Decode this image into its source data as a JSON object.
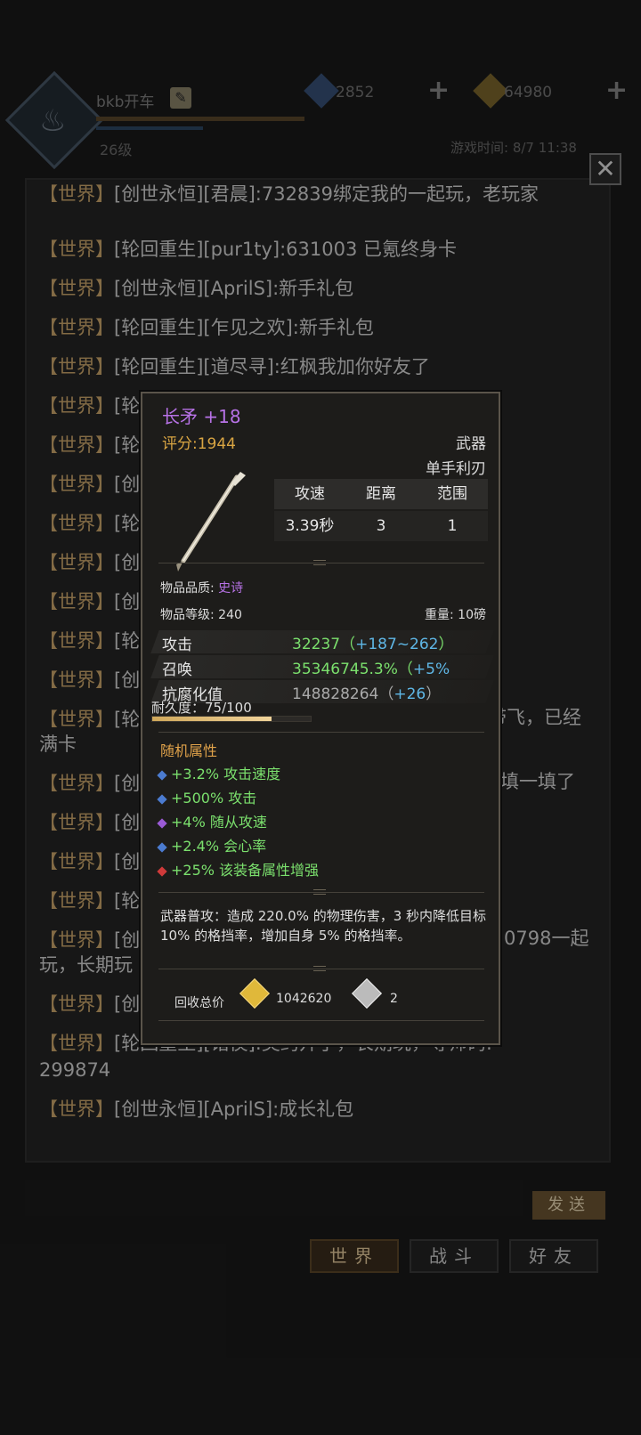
{
  "hud": {
    "player_name": "bkb开车",
    "level": "26级",
    "gems": "2852",
    "gold": "64980",
    "game_time": "游戏时间: 8/7 11:38"
  },
  "chat": {
    "lines": [
      {
        "tag": "【世界】",
        "text": "[创世永恒][君晨]:732839绑定我的一起玩，老玩家"
      },
      {
        "tag": "【世界】",
        "text": "[轮回重生][pur1ty]:631003 已氪终身卡"
      },
      {
        "tag": "【世界】",
        "text": "[创世永恒][AprilS]:新手礼包"
      },
      {
        "tag": "【世界】",
        "text": "[轮回重生][乍见之欢]:新手礼包"
      },
      {
        "tag": "【世界】",
        "text": "[轮回重生][道尽寻]:红枫我加你好友了"
      },
      {
        "tag": "【世界】",
        "text": "[轮"
      },
      {
        "tag": "【世界】",
        "text": "[轮"
      },
      {
        "tag": "【世界】",
        "text": "[创"
      },
      {
        "tag": "【世界】",
        "text": "[轮"
      },
      {
        "tag": "【世界】",
        "text": "[创"
      },
      {
        "tag": "【世界】",
        "text": "[创"
      },
      {
        "tag": "【世界】",
        "text": "[轮"
      },
      {
        "tag": "【世界】",
        "text": "[创"
      },
      {
        "tag": "【世界】",
        "text": "[轮"
      },
      {
        "tag": "",
        "text": "满卡"
      },
      {
        "tag": "【世界】",
        "text": "[创"
      },
      {
        "tag": "【世界】",
        "text": "[创"
      },
      {
        "tag": "【世界】",
        "text": "[创"
      },
      {
        "tag": "【世界】",
        "text": "[轮"
      },
      {
        "tag": "【世界】",
        "text": "[创"
      },
      {
        "tag": "",
        "text": "玩，长期玩"
      },
      {
        "tag": "【世界】",
        "text": "[创"
      },
      {
        "tag": "【世界】",
        "text": "[轮回重生][诸侯]:契约开了，长期玩，导师码:"
      },
      {
        "tag": "",
        "text": "299874"
      },
      {
        "tag": "【世界】",
        "text": "[创世永恒][AprilS]:成长礼包"
      }
    ],
    "right_fragments": [
      "带飞，已经",
      "填一填了",
      "0798一起"
    ],
    "send_label": "发送",
    "tabs": [
      "世界",
      "战斗",
      "好友"
    ]
  },
  "item": {
    "name": "长矛 +18",
    "score": "评分:1944",
    "type": "武器",
    "subtype": "单手利刃",
    "stat_headers": [
      "攻速",
      "距离",
      "范围"
    ],
    "stat_values": [
      "3.39秒",
      "3",
      "1"
    ],
    "quality_label": "物品品质:",
    "quality_value": "史诗",
    "level_label": "物品等级:",
    "level_value": "240",
    "weight_label": "重量:",
    "weight_value": "10磅",
    "attributes": [
      {
        "label": "攻击",
        "value": "32237（",
        "bonus": "+187~262",
        "tail": "）"
      },
      {
        "label": "召唤",
        "value": "35346745.3%（",
        "bonus": "+5%",
        "tail": ""
      },
      {
        "label": "抗腐化值",
        "value": "148828264（",
        "bonus": "+26",
        "tail": "）"
      }
    ],
    "durability_label": "耐久度：75/100",
    "durability_fraction": 0.75,
    "random_title": "随机属性",
    "random_attrs": [
      {
        "text": "+3.2% 攻击速度",
        "gem_color": "#4b7bd0"
      },
      {
        "text": "+500% 攻击",
        "gem_color": "#4b7bd0"
      },
      {
        "text": "+4% 随从攻速",
        "gem_color": "#9b5bd6"
      },
      {
        "text": "+2.4% 会心率",
        "gem_color": "#4b7bd0"
      },
      {
        "text": "+25% 该装备属性增强",
        "gem_color": "#d03a3a"
      }
    ],
    "description": "武器普攻：造成 220.0% 的物理伤害，3 秒内降低目标 10% 的格挡率，增加自身 5% 的格挡率。",
    "recycle_label": "回收总价",
    "recycle_gold": "1042620",
    "recycle_stone": "2"
  }
}
